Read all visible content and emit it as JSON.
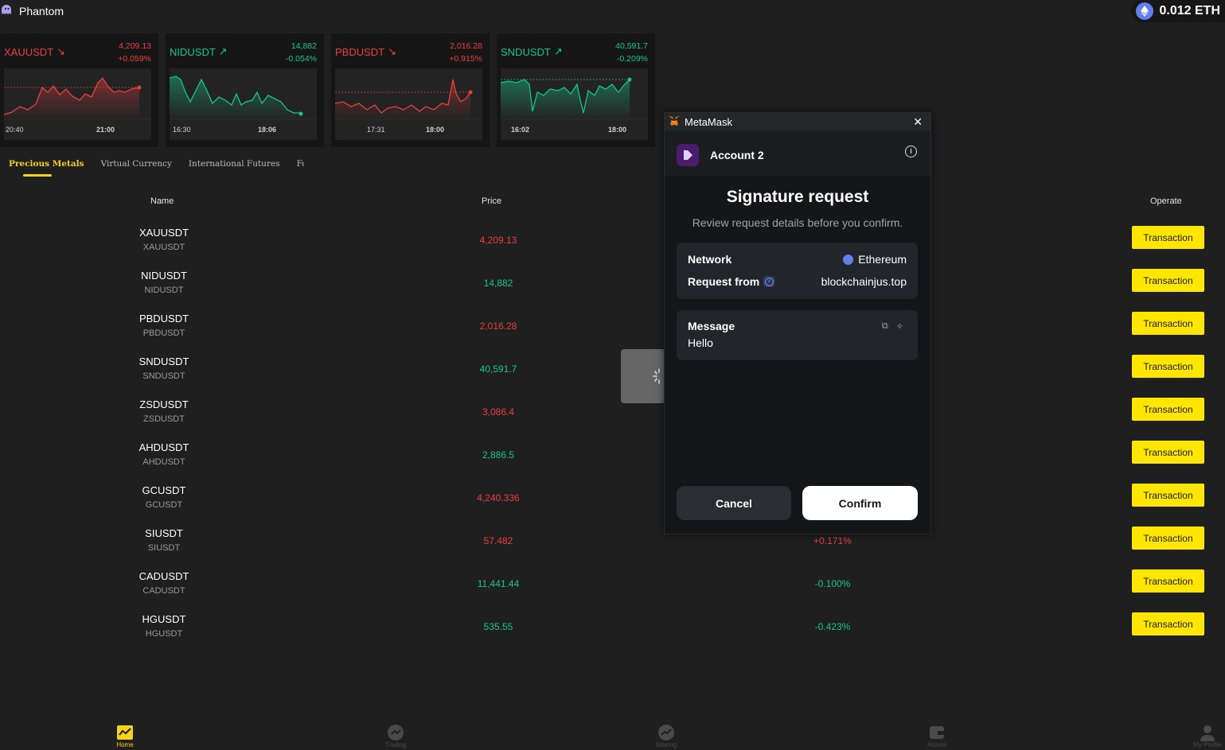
{
  "app": {
    "name": "Phantom",
    "balance": "0.012 ETH"
  },
  "tickers": [
    {
      "symbol": "XAUUSDT",
      "price": "4,209.13",
      "change": "+0.059%",
      "trend": "down",
      "color": "#e84040",
      "t1": "20:40",
      "t2": "21:00"
    },
    {
      "symbol": "NIDUSDT",
      "price": "14,882",
      "change": "-0.054%",
      "trend": "up",
      "color": "#18c48c",
      "t1": "16:30",
      "t2": "18:06"
    },
    {
      "symbol": "PBDUSDT",
      "price": "2,016.28",
      "change": "+0.915%",
      "trend": "down",
      "color": "#e84040",
      "t1": "17:31",
      "t2": "18:00"
    },
    {
      "symbol": "SNDUSDT",
      "price": "40,591.7",
      "change": "-0.209%",
      "trend": "up",
      "color": "#18c48c",
      "t1": "16:02",
      "t2": "18:00"
    }
  ],
  "tabs": [
    "Precious Metals",
    "Virtual Currency",
    "International Futures",
    "Fo"
  ],
  "table": {
    "headers": {
      "name": "Name",
      "price": "Price",
      "operate": "Operate"
    },
    "rows": [
      {
        "name": "XAUUSDT",
        "sub": "XAUUSDT",
        "price": "4,209.13",
        "price_color": "red",
        "change": "",
        "change_color": "red",
        "action": "Transaction"
      },
      {
        "name": "NIDUSDT",
        "sub": "NIDUSDT",
        "price": "14,882",
        "price_color": "green",
        "change": "",
        "change_color": "green",
        "action": "Transaction"
      },
      {
        "name": "PBDUSDT",
        "sub": "PBDUSDT",
        "price": "2,016.28",
        "price_color": "red",
        "change": "",
        "change_color": "red",
        "action": "Transaction"
      },
      {
        "name": "SNDUSDT",
        "sub": "SNDUSDT",
        "price": "40,591.7",
        "price_color": "green",
        "change": "",
        "change_color": "green",
        "action": "Transaction"
      },
      {
        "name": "ZSDUSDT",
        "sub": "ZSDUSDT",
        "price": "3,086.4",
        "price_color": "red",
        "change": "",
        "change_color": "red",
        "action": "Transaction"
      },
      {
        "name": "AHDUSDT",
        "sub": "AHDUSDT",
        "price": "2,886.5",
        "price_color": "green",
        "change": "",
        "change_color": "green",
        "action": "Transaction"
      },
      {
        "name": "GCUSDT",
        "sub": "GCUSDT",
        "price": "4,240.336",
        "price_color": "red",
        "change": "",
        "change_color": "red",
        "action": "Transaction"
      },
      {
        "name": "SIUSDT",
        "sub": "SIUSDT",
        "price": "57.482",
        "price_color": "red",
        "change": "+0.171%",
        "change_color": "red",
        "action": "Transaction"
      },
      {
        "name": "CADUSDT",
        "sub": "CADUSDT",
        "price": "11,441.44",
        "price_color": "green",
        "change": "-0.100%",
        "change_color": "green",
        "action": "Transaction"
      },
      {
        "name": "HGUSDT",
        "sub": "HGUSDT",
        "price": "535.55",
        "price_color": "green",
        "change": "-0.423%",
        "change_color": "green",
        "action": "Transaction"
      }
    ]
  },
  "nav": [
    {
      "label": "Home",
      "icon": "chart-icon",
      "active": true
    },
    {
      "label": "Trading",
      "icon": "trading-icon",
      "active": false
    },
    {
      "label": "Staking",
      "icon": "staking-icon",
      "active": false
    },
    {
      "label": "Assets",
      "icon": "wallet-icon",
      "active": false
    },
    {
      "label": "My Profile",
      "icon": "user-icon",
      "active": false
    }
  ],
  "metamask": {
    "window_title": "MetaMask",
    "account": "Account 2",
    "heading": "Signature request",
    "subheading": "Review request details before you confirm.",
    "network_label": "Network",
    "network_value": "Ethereum",
    "request_from_label": "Request from",
    "request_from_value": "blockchainjus.top",
    "message_label": "Message",
    "message_value": "Hello",
    "cancel": "Cancel",
    "confirm": "Confirm"
  },
  "colors": {
    "accent": "#ffe600",
    "up": "#18c48c",
    "down": "#e84040"
  }
}
